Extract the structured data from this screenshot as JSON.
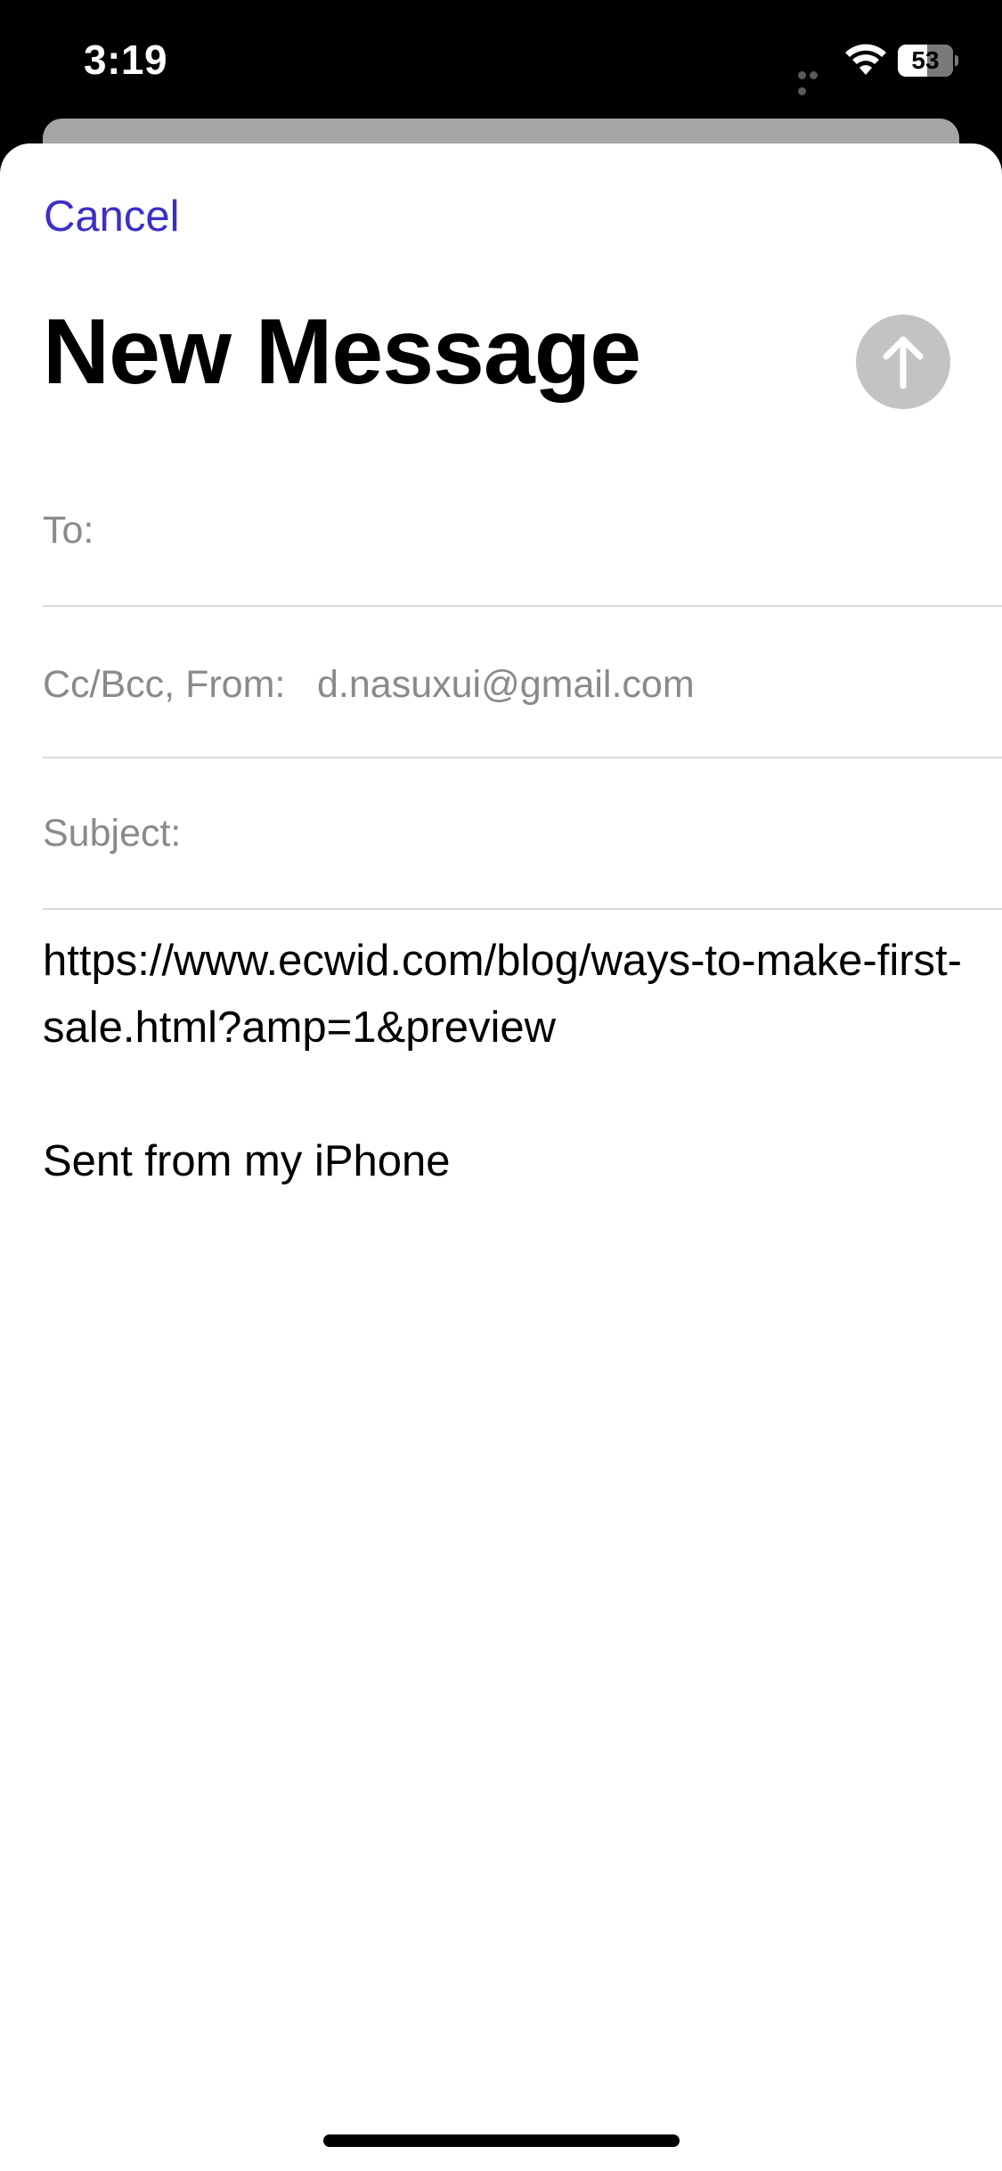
{
  "status_bar": {
    "time": "3:19",
    "battery_level": "53",
    "icons": [
      "signal-dots-icon",
      "wifi-icon",
      "battery-icon"
    ]
  },
  "compose": {
    "cancel_label": "Cancel",
    "title": "New Message",
    "send_icon": "arrow-up-icon",
    "fields": {
      "to_label": "To:",
      "to_value": "",
      "ccbcc_from_label": "Cc/Bcc, From:",
      "from_value": "d.nasuxui@gmail.com",
      "subject_label": "Subject:",
      "subject_value": ""
    },
    "body": {
      "link_text": "https://www.ecwid.com/blog/ways-to-make-first-sale.html?amp=1&preview",
      "signature": "Sent from my iPhone"
    }
  },
  "colors": {
    "accent": "#3d2fc4",
    "send_button_disabled": "#c3c3c5",
    "field_label": "#8a8a8e",
    "separator": "#d9d9dc"
  }
}
